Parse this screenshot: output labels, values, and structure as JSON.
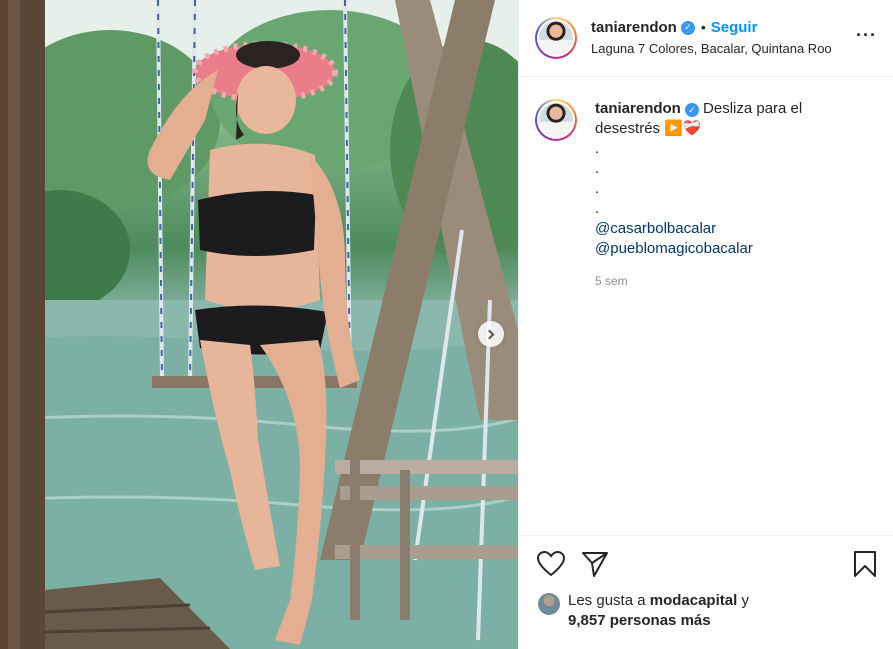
{
  "header": {
    "username": "taniarendon",
    "verified_badge": "✓",
    "separator": "•",
    "follow_label": "Seguir",
    "location": "Laguna 7 Colores, Bacalar, Quintana Roo",
    "more_label": "···"
  },
  "caption": {
    "username": "taniarendon",
    "text_line1": "Desliza para el",
    "text_line2": "desestrés",
    "emoji_play": "▶️",
    "emoji_heart": "❤️‍🩹",
    "dots": [
      ".",
      ".",
      ".",
      "."
    ],
    "mentions": [
      "@casarbolbacalar",
      "@pueblomagicobacalar"
    ],
    "time": "5 sem"
  },
  "likes": {
    "prefix": "Les gusta a",
    "user": "modacapital",
    "connector": "y",
    "others": "9,857 personas más"
  },
  "icons": {
    "like": "heart-icon",
    "share": "paper-plane-icon",
    "save": "bookmark-icon",
    "carousel": "chevron-right-icon"
  },
  "colors": {
    "accent": "#0095f6",
    "verified": "#3897f0",
    "mention": "#00376b",
    "muted": "#8e8e8e"
  }
}
